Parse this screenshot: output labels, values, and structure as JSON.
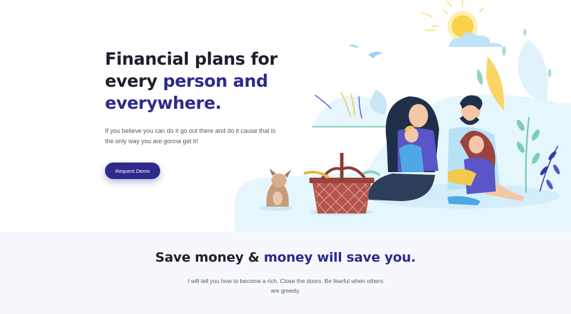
{
  "hero": {
    "title_line1": "Financial plans for",
    "title_line2_plain": "every ",
    "title_line2_accent": "person and",
    "title_line3_accent": "everywhere.",
    "subtitle": "If you believe you can do it go out there and do it cause that is the only way you are gonna get it!",
    "cta_label": "Request Demo"
  },
  "section": {
    "title_plain": "Save money & ",
    "title_accent": "money will save you.",
    "subtitle": "I will tell you how to become a rich. Close the doors. Be fearful when others are greedy."
  },
  "colors": {
    "accent": "#2d2a8c",
    "heading": "#1f1f2b",
    "body_text": "#555a66",
    "section_bg": "#f7f8fd",
    "illustration_bg": "#e6f6fd"
  },
  "illustration": {
    "icons": [
      "sun-icon",
      "cloud-icon",
      "bird-icon",
      "leaf-icon",
      "picnic-basket-icon",
      "dog-icon",
      "family-icon",
      "plant-icon"
    ]
  }
}
